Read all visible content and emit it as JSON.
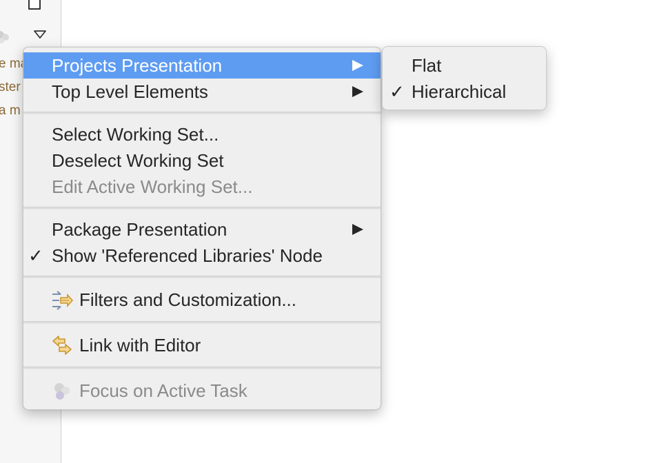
{
  "background": {
    "left_texts": [
      "e ma",
      "ster",
      "a m"
    ]
  },
  "menu": {
    "items": [
      {
        "label": "Projects Presentation",
        "has_submenu": true,
        "highlighted": true
      },
      {
        "label": "Top Level Elements",
        "has_submenu": true
      },
      {
        "label": "Select Working Set..."
      },
      {
        "label": "Deselect Working Set"
      },
      {
        "label": "Edit Active Working Set...",
        "disabled": true
      },
      {
        "label": "Package Presentation",
        "has_submenu": true
      },
      {
        "label": "Show 'Referenced Libraries' Node",
        "checked": true
      },
      {
        "label": "Filters and Customization...",
        "icon": "filters-icon"
      },
      {
        "label": "Link with Editor",
        "icon": "link-with-editor-icon"
      },
      {
        "label": "Focus on Active Task",
        "icon": "focus-task-icon",
        "disabled": true
      }
    ],
    "check_glyph": "✓"
  },
  "submenu": {
    "items": [
      {
        "label": "Flat"
      },
      {
        "label": "Hierarchical",
        "checked": true
      }
    ]
  },
  "colors": {
    "highlight": "#5e9cf2",
    "menu_bg": "#efefef",
    "text": "#262626",
    "disabled_text": "#8a8a8a"
  }
}
